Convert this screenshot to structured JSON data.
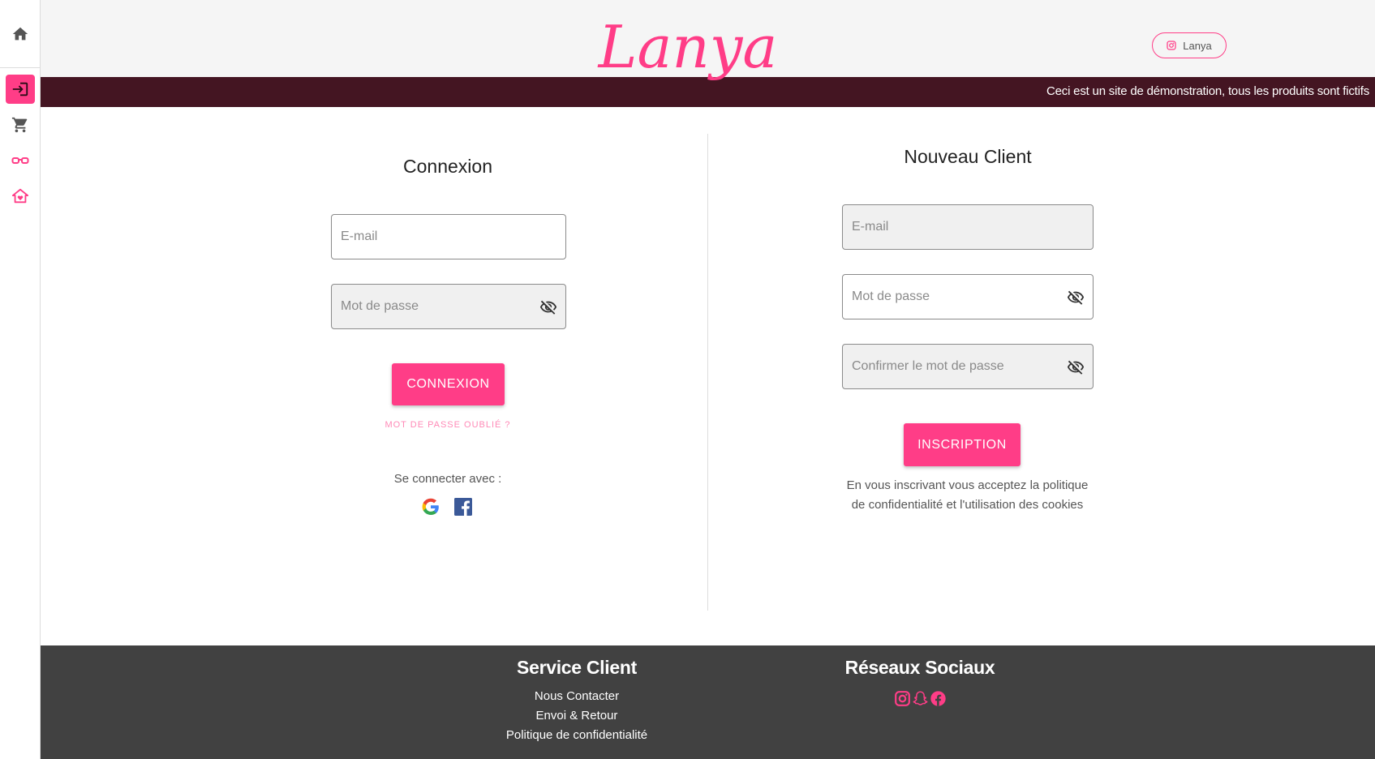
{
  "brand": {
    "logo_text": "Lanya",
    "accent_color": "#ff3d87",
    "banner_color": "#441522",
    "footer_color": "#414141"
  },
  "header": {
    "instagram_label": "Lanya",
    "banner_text": "Ceci est un site de démonstration, tous les produits sont fictifs"
  },
  "sidebar": {
    "items": [
      {
        "name": "home-icon"
      },
      {
        "name": "login-icon",
        "active": true
      },
      {
        "name": "cart-icon"
      },
      {
        "name": "glasses-icon"
      },
      {
        "name": "house-heart-icon"
      }
    ]
  },
  "login": {
    "title": "Connexion",
    "email_placeholder": "E-mail",
    "password_placeholder": "Mot de passe",
    "submit_label": "CONNEXION",
    "forgot_label": "MOT DE PASSE OUBLIÉ ?",
    "social_label": "Se connecter avec :"
  },
  "register": {
    "title": "Nouveau Client",
    "email_placeholder": "E-mail",
    "password_placeholder": "Mot de passe",
    "confirm_placeholder": "Confirmer le mot de passe",
    "submit_label": "INSCRIPTION",
    "terms_line1": "En vous inscrivant vous acceptez la politique",
    "terms_line2": "de confidentialité et l'utilisation des cookies"
  },
  "footer": {
    "service_title": "Service Client",
    "links": [
      "Nous Contacter",
      "Envoi & Retour",
      "Politique de confidentialité"
    ],
    "social_title": "Réseaux Sociaux"
  }
}
